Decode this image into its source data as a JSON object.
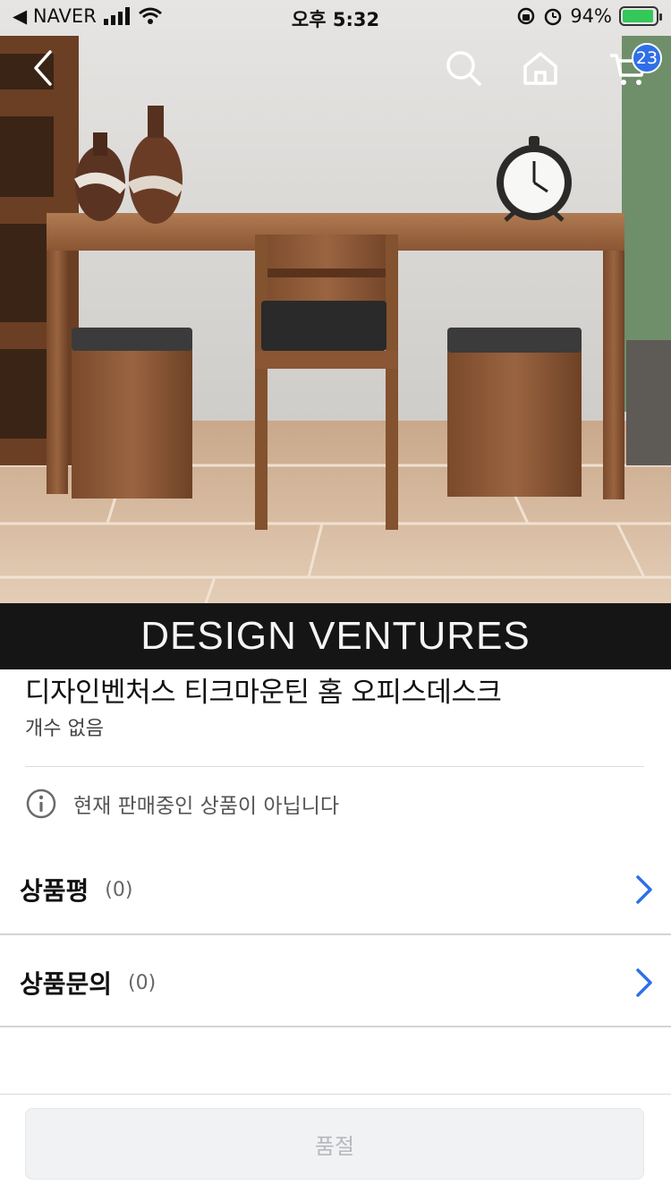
{
  "status_bar": {
    "carrier": "◀ NAVER",
    "time": "오후 5:32",
    "battery": "94%",
    "battery_level": 0.94
  },
  "nav": {
    "cart_count": "23"
  },
  "hero": {
    "brand_banner": "DESIGN VENTURES"
  },
  "product": {
    "title": "디자인벤처스 티크마운틴 홈 오피스데스크",
    "subtitle": "개수 없음"
  },
  "notice": {
    "text": "현재 판매중인 상품이 아닙니다"
  },
  "reviews": {
    "label": "상품평",
    "count": "(0)"
  },
  "inquiries": {
    "label": "상품문의",
    "count": "(0)"
  },
  "purchase": {
    "soldout_label": "품절"
  },
  "colors": {
    "accent": "#2f6fe8",
    "banner_bg": "#151515"
  }
}
